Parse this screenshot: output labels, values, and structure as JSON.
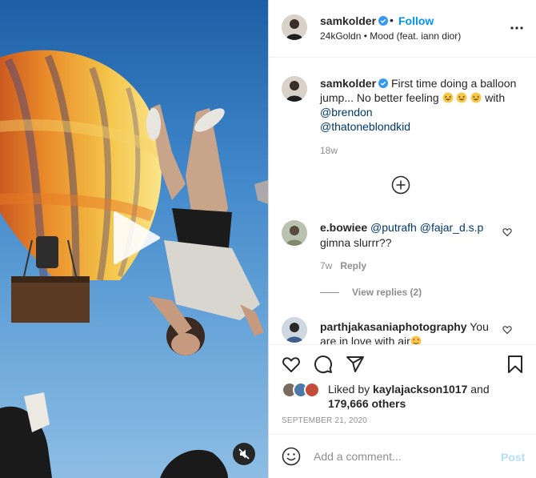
{
  "header": {
    "username": "samkolder",
    "dot": "•",
    "follow_label": "Follow",
    "audio": "24kGoldn • Mood (feat. iann dior)"
  },
  "caption": {
    "username": "samkolder",
    "text_part1": "First time doing a balloon jump... No better feeling",
    "text_part2": "with",
    "mention1": "@brendon",
    "mention2": "@thatoneblondkid",
    "time": "18w"
  },
  "comments": [
    {
      "username": "e.bowiee",
      "mention1": "@putrafh",
      "mention2": "@fajar_d.s.p",
      "text": "gimna slurrr??",
      "time": "7w",
      "reply_label": "Reply",
      "view_replies": "View replies (2)"
    },
    {
      "username": "parthjakasaniaphotography",
      "text": "You are in love with air"
    }
  ],
  "likes": {
    "prefix": "Liked by",
    "user": "kaylajackson1017",
    "and": "and",
    "count": "179,666 others"
  },
  "date": "SEPTEMBER 21, 2020",
  "add_comment": {
    "placeholder": "Add a comment...",
    "post_label": "Post"
  },
  "icons": {
    "verified": "verified-badge-icon",
    "more": "more-options-icon",
    "add": "plus-circle-icon",
    "like": "heart-icon",
    "comment": "comment-icon",
    "share": "paper-plane-icon",
    "save": "bookmark-icon",
    "emoji": "smiley-icon",
    "play": "play-icon",
    "mute": "muted-speaker-icon"
  },
  "colors": {
    "accent": "#0095f6",
    "mention": "#00376b",
    "secondary_text": "#8e8e8e",
    "post_disabled": "#b2dffc"
  }
}
